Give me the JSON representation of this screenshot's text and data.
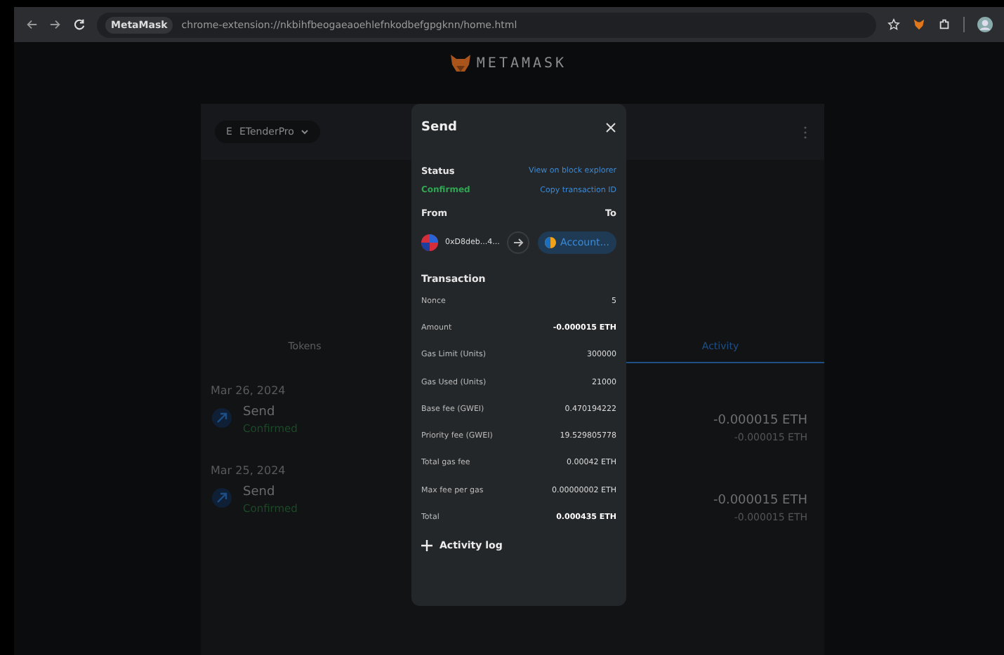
{
  "browser": {
    "site_chip": "MetaMask",
    "url": "chrome-extension://nkbihfbeogaeaoehlefnkodbefgpgknn/home.html"
  },
  "logo_text": "METAMASK",
  "account": {
    "initial": "E",
    "name": "ETenderPro"
  },
  "tabs": [
    {
      "label": "Tokens",
      "selected": false
    },
    {
      "label": "Activity",
      "selected": true
    }
  ],
  "activity": [
    {
      "date": "Mar 26, 2024",
      "items": [
        {
          "title": "Send",
          "status": "Confirmed",
          "amount": "-0.000015 ETH",
          "secondary": "-0.000015 ETH"
        }
      ]
    },
    {
      "date": "Mar 25, 2024",
      "items": [
        {
          "title": "Send",
          "status": "Confirmed",
          "amount": "-0.000015 ETH",
          "secondary": "-0.000015 ETH"
        }
      ]
    }
  ],
  "modal": {
    "title": "Send",
    "status_label": "Status",
    "status_value": "Confirmed",
    "explorer_link": "View on block explorer",
    "copy_link": "Copy transaction ID",
    "from_label": "From",
    "to_label": "To",
    "from_address": "0xD8deb...4...",
    "to_account": "Account...",
    "section_title": "Transaction",
    "rows": [
      {
        "label": "Nonce",
        "value": "5",
        "bold": false
      },
      {
        "label": "Amount",
        "value": "-0.000015 ETH",
        "bold": true
      },
      {
        "label": "Gas Limit (Units)",
        "value": "300000",
        "bold": false
      },
      {
        "label": "Gas Used (Units)",
        "value": "21000",
        "bold": false
      },
      {
        "label": "Base fee (GWEI)",
        "value": "0.470194222",
        "bold": false
      },
      {
        "label": "Priority fee (GWEI)",
        "value": "19.529805778",
        "bold": false
      },
      {
        "label": "Total gas fee",
        "value": "0.00042 ETH",
        "bold": false
      },
      {
        "label": "Max fee per gas",
        "value": "0.00000002 ETH",
        "bold": false
      },
      {
        "label": "Total",
        "value": "0.000435 ETH",
        "bold": true
      }
    ],
    "activity_log": "Activity log"
  }
}
